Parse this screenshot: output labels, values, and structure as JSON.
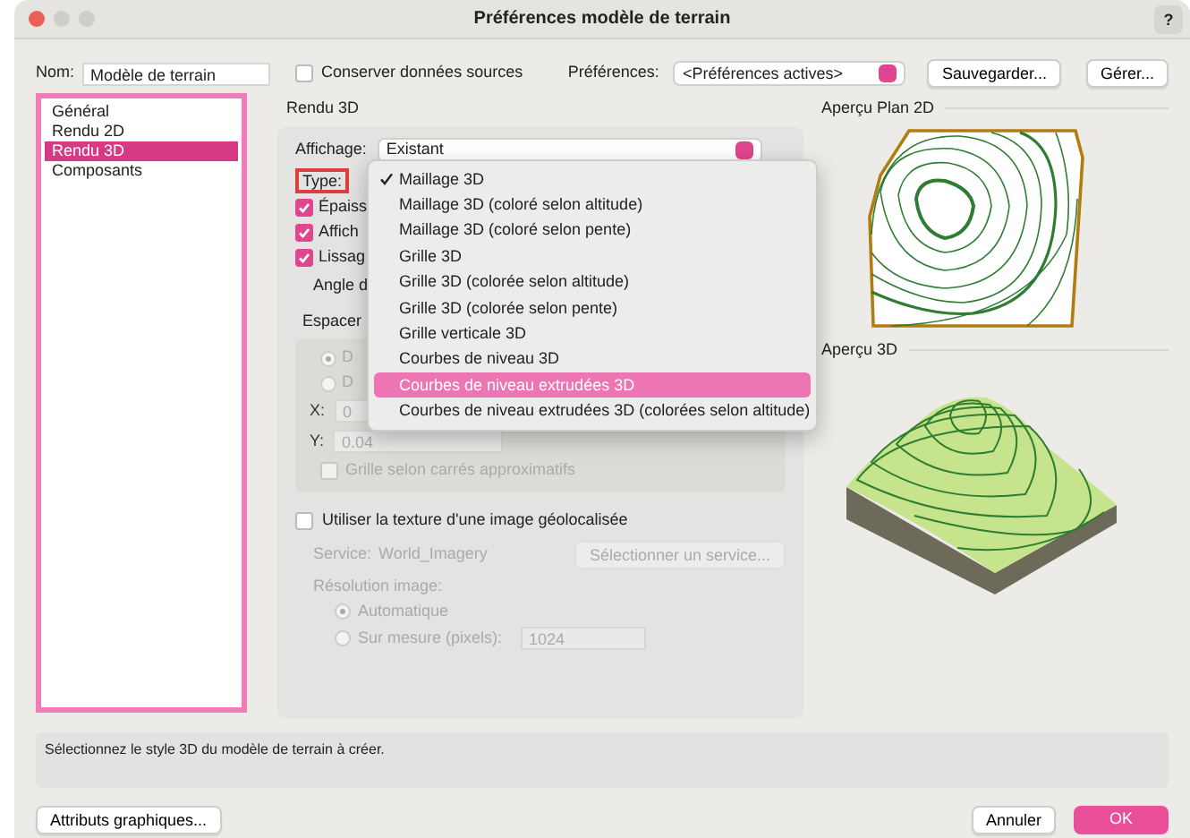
{
  "window": {
    "title": "Préférences modèle de terrain",
    "help": "?"
  },
  "header": {
    "name_label": "Nom:",
    "name_value": "Modèle de terrain",
    "keep_source": {
      "label": "Conserver données sources",
      "checked": false
    },
    "prefs_label": "Préférences:",
    "prefs_value": "<Préférences actives>",
    "save_button": "Sauvegarder...",
    "manage_button": "Gérer..."
  },
  "sidebar": {
    "items": [
      {
        "label": "Général",
        "selected": false
      },
      {
        "label": "Rendu 2D",
        "selected": false
      },
      {
        "label": "Rendu 3D",
        "selected": true
      },
      {
        "label": "Composants",
        "selected": false
      }
    ]
  },
  "panel": {
    "title": "Rendu 3D",
    "display_label": "Affichage:",
    "display_value": "Existant",
    "type_label": "Type:",
    "options": [
      {
        "label": "Épaiss",
        "checked": true
      },
      {
        "label": "Affich",
        "checked": true
      },
      {
        "label": "Lissag",
        "checked": true
      }
    ],
    "angle_label": "Angle d",
    "spacing_label": "Espacer",
    "spacing_radios": [
      {
        "label": "D",
        "selected": true
      },
      {
        "label": "D",
        "selected": false
      }
    ],
    "x_label": "X:",
    "x_value": "0",
    "y_label": "Y:",
    "y_value": "0.04",
    "grid_checkbox": {
      "label": "Grille selon carrés approximatifs",
      "checked": false
    },
    "texture_checkbox": {
      "label": "Utiliser la texture d'une image géolocalisée",
      "checked": false
    },
    "service_label": "Service:",
    "service_value": "World_Imagery",
    "service_button": "Sélectionner un service...",
    "resolution_label": "Résolution image:",
    "resolution_radios": [
      {
        "label": "Automatique",
        "selected": true
      },
      {
        "label": "Sur mesure (pixels):",
        "selected": false
      }
    ],
    "custom_value": "1024"
  },
  "type_menu": {
    "items": [
      {
        "label": "Maillage 3D",
        "checked": true,
        "selected": false
      },
      {
        "label": "Maillage 3D (coloré selon altitude)",
        "checked": false,
        "selected": false
      },
      {
        "label": "Maillage 3D (coloré selon pente)",
        "checked": false,
        "selected": false
      },
      {
        "label": "Grille 3D",
        "checked": false,
        "selected": false
      },
      {
        "label": "Grille 3D (colorée selon altitude)",
        "checked": false,
        "selected": false
      },
      {
        "label": "Grille 3D (colorée selon pente)",
        "checked": false,
        "selected": false
      },
      {
        "label": "Grille verticale 3D",
        "checked": false,
        "selected": false
      },
      {
        "label": "Courbes de niveau 3D",
        "checked": false,
        "selected": false
      },
      {
        "label": "Courbes de niveau extrudées 3D",
        "checked": false,
        "selected": true
      },
      {
        "label": "Courbes de niveau extrudées 3D (colorées selon altitude)",
        "checked": false,
        "selected": false
      }
    ]
  },
  "previews": {
    "plan_title": "Aperçu Plan 2D",
    "view_title": "Aperçu 3D"
  },
  "status": "Sélectionnez le style 3D du modèle de terrain à créer.",
  "footer": {
    "graphics_button": "Attributs graphiques...",
    "cancel_button": "Annuler",
    "ok_button": "OK"
  }
}
